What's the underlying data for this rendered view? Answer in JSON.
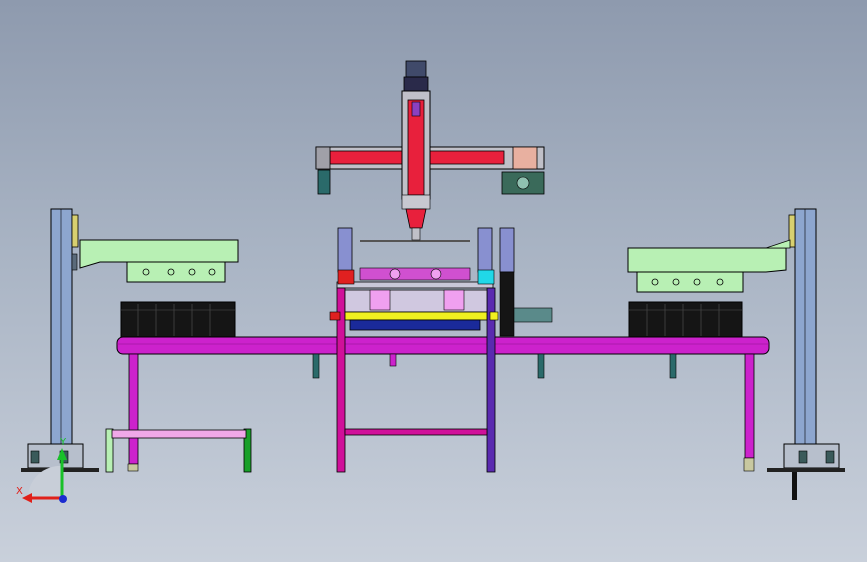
{
  "axis_triad": {
    "x_label": "X",
    "y_label": "Y",
    "colors": {
      "x": "#e0201a",
      "y": "#18c028",
      "z": "#1a2bd0"
    }
  },
  "palette": {
    "conveyor": "#cc22cc",
    "gantry_beam": "#e8203c",
    "tray": "#b8f0b4",
    "pillar": "#8da6cf",
    "cylinder": "#8890d0",
    "cyan": "#20d8e8",
    "dark_feet": "#2a6a6a",
    "base_frame": "#d0109a"
  }
}
